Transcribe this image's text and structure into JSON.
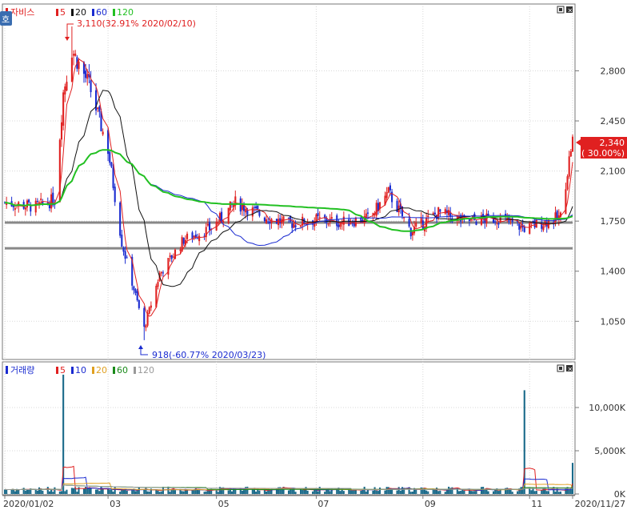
{
  "stock_name": "자비스",
  "price_panel": {
    "title": "자비스",
    "ma_legend": [
      {
        "label": "5",
        "color": "#e02020"
      },
      {
        "label": "20",
        "color": "#111111"
      },
      {
        "label": "60",
        "color": "#1a2bd0"
      },
      {
        "label": "120",
        "color": "#22c022"
      }
    ],
    "side_badge": "호",
    "y_ticks": [
      "2,800",
      "2,450",
      "2,100",
      "1,750",
      "1,400",
      "1,050"
    ],
    "y_range": [
      800,
      3250
    ],
    "current_price": "2,340",
    "current_change": "( 30.00%)",
    "high_note": "3,110(32.91% 2020/02/10)",
    "low_note": "918(-60.77% 2020/03/23)",
    "horizontal_lines": [
      1740,
      1560
    ]
  },
  "volume_panel": {
    "title": "거래량",
    "ma_legend": [
      {
        "label": "5",
        "color": "#e02020"
      },
      {
        "label": "10",
        "color": "#1a2bd0"
      },
      {
        "label": "20",
        "color": "#e0a020"
      },
      {
        "label": "60",
        "color": "#1a8a1a"
      },
      {
        "label": "120",
        "color": "#999999"
      }
    ],
    "y_ticks": [
      "10,000K",
      "5,000K",
      "0K"
    ],
    "y_range": [
      0,
      15000
    ]
  },
  "x_axis_labels": [
    "2020/01/02",
    "03",
    "05",
    "07",
    "09",
    "11",
    "2020/11/27"
  ],
  "colors": {
    "up": "#e02020",
    "down": "#1a2bd0",
    "grid": "#d8d8d8",
    "hline": "#888888"
  },
  "chart_data": {
    "type": "candlestick",
    "x_range": [
      "2020/01/02",
      "2020/11/27"
    ],
    "price_anchors": [
      {
        "date": "2020/01/02",
        "close": 1880
      },
      {
        "date": "2020/01/20",
        "close": 1850
      },
      {
        "date": "2020/01/31",
        "close": 1900
      },
      {
        "date": "2020/02/05",
        "close": 2650
      },
      {
        "date": "2020/02/10",
        "close": 2950
      },
      {
        "date": "2020/02/20",
        "close": 2700
      },
      {
        "date": "2020/03/02",
        "close": 2250
      },
      {
        "date": "2020/03/10",
        "close": 1600
      },
      {
        "date": "2020/03/23",
        "close": 1000
      },
      {
        "date": "2020/04/01",
        "close": 1380
      },
      {
        "date": "2020/04/15",
        "close": 1620
      },
      {
        "date": "2020/05/01",
        "close": 1700
      },
      {
        "date": "2020/05/15",
        "close": 1880
      },
      {
        "date": "2020/06/01",
        "close": 1780
      },
      {
        "date": "2020/06/15",
        "close": 1730
      },
      {
        "date": "2020/07/01",
        "close": 1760
      },
      {
        "date": "2020/07/15",
        "close": 1740
      },
      {
        "date": "2020/08/01",
        "close": 1770
      },
      {
        "date": "2020/08/12",
        "close": 1950
      },
      {
        "date": "2020/08/25",
        "close": 1680
      },
      {
        "date": "2020/09/10",
        "close": 1810
      },
      {
        "date": "2020/09/25",
        "close": 1750
      },
      {
        "date": "2020/10/15",
        "close": 1770
      },
      {
        "date": "2020/10/30",
        "close": 1700
      },
      {
        "date": "2020/11/10",
        "close": 1740
      },
      {
        "date": "2020/11/20",
        "close": 1780
      },
      {
        "date": "2020/11/27",
        "close": 2340
      }
    ],
    "volume_spikes": [
      {
        "date": "2020/02/05",
        "volume": 13800
      },
      {
        "date": "2020/10/30",
        "volume": 12000
      },
      {
        "date": "2020/11/27",
        "volume": 3600
      }
    ],
    "high": {
      "value": 3110,
      "date": "2020/02/10"
    },
    "low": {
      "value": 918,
      "date": "2020/03/23"
    }
  }
}
